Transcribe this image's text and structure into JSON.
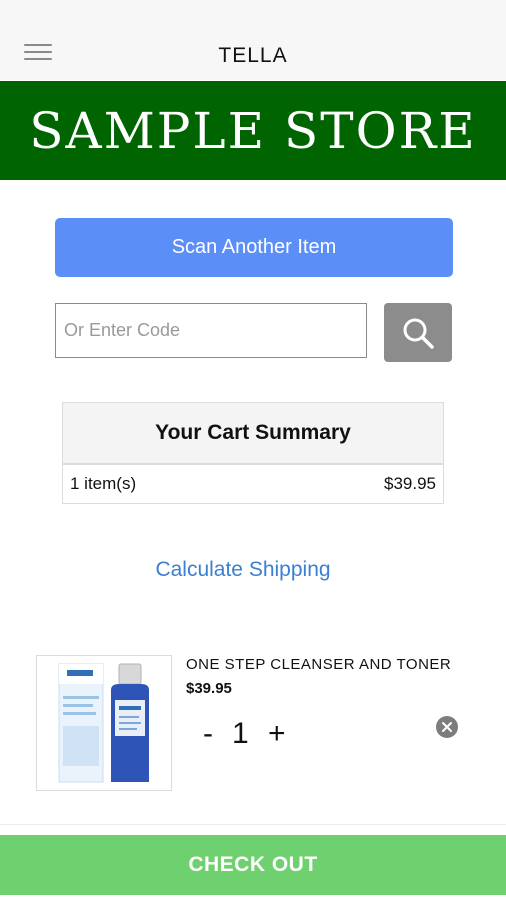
{
  "header": {
    "title": "TELLA",
    "menu_icon": "hamburger-menu-icon"
  },
  "banner": {
    "text": "SAMPLE STORE",
    "background": "#006400"
  },
  "scan": {
    "label": "Scan Another Item",
    "color": "#5b8ff7"
  },
  "search": {
    "placeholder": "Or Enter Code",
    "value": "",
    "icon": "search-icon"
  },
  "cart_summary": {
    "title": "Your Cart Summary",
    "item_count": "1 item(s)",
    "total": "$39.95"
  },
  "shipping": {
    "link_label": "Calculate Shipping"
  },
  "cart_items": [
    {
      "name": "ONE STEP CLEANSER AND TONER",
      "price": "$39.95",
      "quantity": "1",
      "minus_label": "-",
      "plus_label": "+",
      "image_alt": "product-image",
      "remove_icon": "close-icon"
    }
  ],
  "checkout": {
    "label": "CHECK OUT",
    "color": "#6fd06f"
  }
}
